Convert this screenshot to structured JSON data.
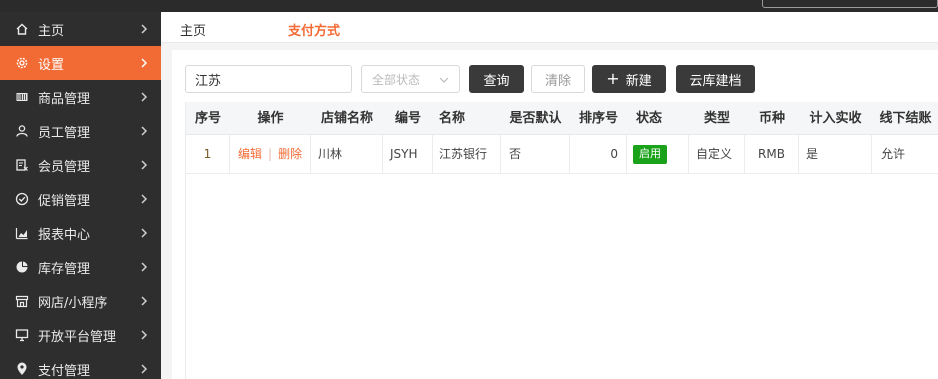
{
  "sidebar": {
    "items": [
      {
        "label": "主页",
        "icon": "home-icon"
      },
      {
        "label": "设置",
        "icon": "gear-icon",
        "active": true
      },
      {
        "label": "商品管理",
        "icon": "barcode-icon"
      },
      {
        "label": "员工管理",
        "icon": "user-icon"
      },
      {
        "label": "会员管理",
        "icon": "member-card-icon"
      },
      {
        "label": "促销管理",
        "icon": "check-circle-icon"
      },
      {
        "label": "报表中心",
        "icon": "bar-chart-icon"
      },
      {
        "label": "库存管理",
        "icon": "pie-chart-icon"
      },
      {
        "label": "网店/小程序",
        "icon": "store-icon"
      },
      {
        "label": "开放平台管理",
        "icon": "monitor-icon"
      },
      {
        "label": "支付管理",
        "icon": "location-pin-icon"
      }
    ]
  },
  "tabs": {
    "home": "主页",
    "current": "支付方式"
  },
  "search": {
    "value": "江苏",
    "status_placeholder": "全部状态"
  },
  "toolbar": {
    "query": "查询",
    "clear": "清除",
    "new": "新建",
    "new_icon": "+",
    "cloud": "云库建档"
  },
  "table": {
    "headers": [
      "序号",
      "操作",
      "店铺名称",
      "编号",
      "名称",
      "是否默认",
      "排序号",
      "状态",
      "类型",
      "币种",
      "计入实收",
      "线下结账"
    ],
    "rows": [
      {
        "index": "1",
        "edit": "编辑",
        "sep": "|",
        "delete": "删除",
        "store": "川林",
        "code": "JSYH",
        "name": "江苏银行",
        "default": "否",
        "sort": "0",
        "status": "启用",
        "type": "自定义",
        "currency": "RMB",
        "count_received": "是",
        "offline": "允许"
      }
    ]
  },
  "colors": {
    "accent": "#f26b34",
    "sidebar_bg": "#2e2e2e",
    "status_green": "#1aa21a",
    "dark_button": "#3a3a3a"
  }
}
